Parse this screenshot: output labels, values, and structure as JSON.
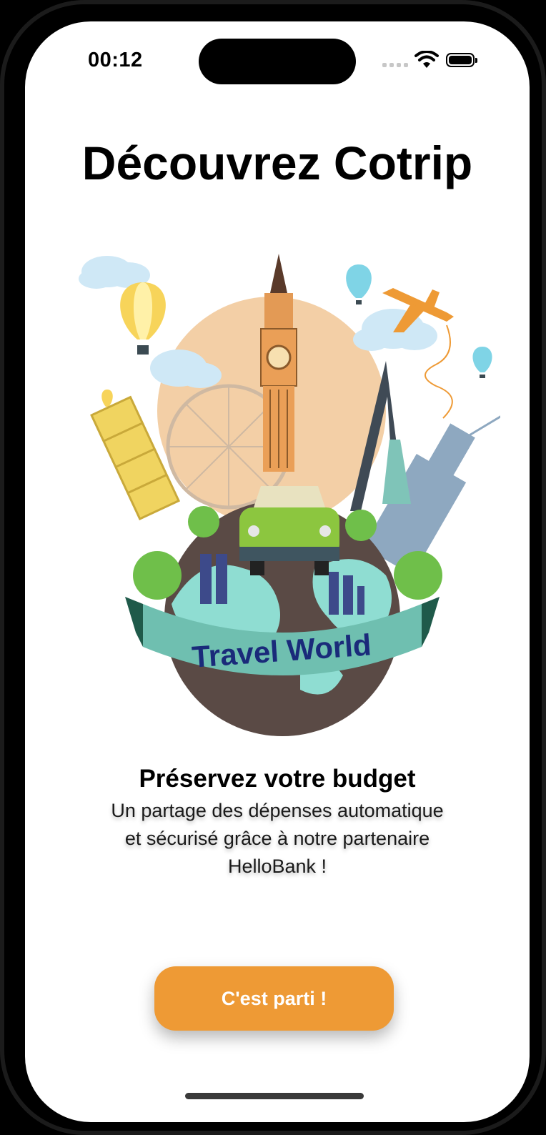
{
  "status_bar": {
    "time": "00:12",
    "icons": [
      "cellular-signal-icon",
      "wifi-icon",
      "battery-icon"
    ]
  },
  "onboarding": {
    "title": "Découvrez Cotrip",
    "illustration_banner": "Travel World",
    "subtitle": "Préservez votre budget",
    "description": "Un partage des dépenses automatique et sécurisé grâce à notre partenaire HelloBank !",
    "cta_label": "C'est parti !"
  },
  "colors": {
    "accent": "#ee9a35",
    "background": "#ffffff",
    "text": "#000000"
  }
}
